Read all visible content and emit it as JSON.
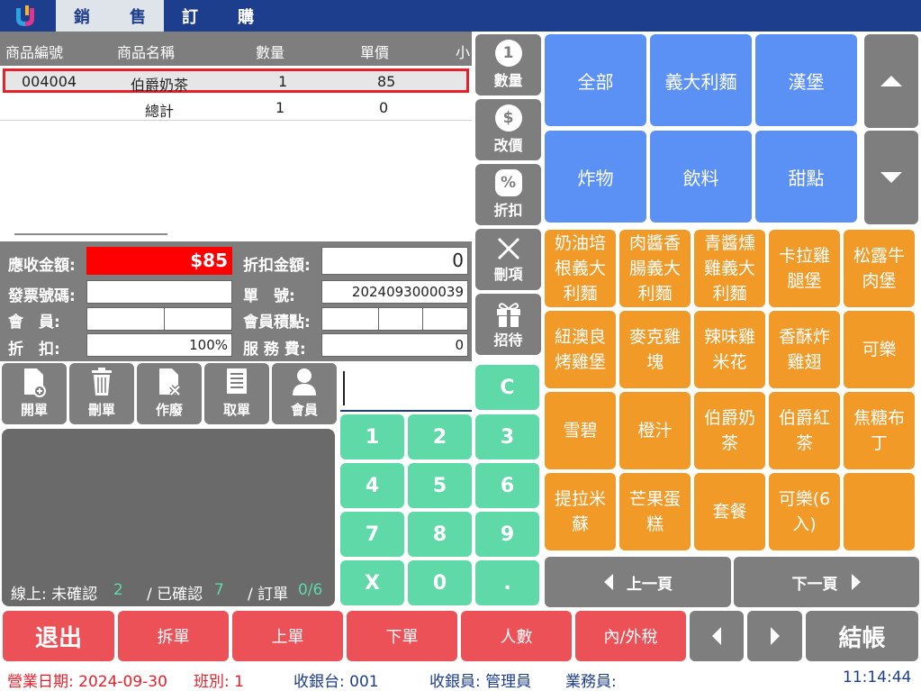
{
  "tabs": [
    {
      "label1": "銷",
      "label2": "售"
    },
    {
      "label1": "訂",
      "label2": "購"
    }
  ],
  "table": {
    "headers": [
      "商品編號",
      "商品名稱",
      "數量",
      "單價",
      "小"
    ],
    "rows": [
      {
        "code": "004004",
        "name": "伯爵奶茶",
        "qty": "1",
        "price": "85"
      }
    ],
    "total": {
      "label": "總計",
      "qty": "1",
      "price": "0"
    }
  },
  "info": {
    "receivable_label": "應收金額:",
    "receivable_value": "$85",
    "discount_amount_label": "折扣金額:",
    "discount_amount_value": "0",
    "invoice_label": "發票號碼:",
    "invoice_value": "",
    "order_no_label": "單　號:",
    "order_no_value": "2024093000039",
    "member_label": "會　員:",
    "member_points_label": "會員積點:",
    "discount_label": "折　扣:",
    "discount_value": "100%",
    "service_label": "服 務 費:",
    "service_value": "0"
  },
  "actions": [
    "開單",
    "刪單",
    "作廢",
    "取單",
    "會員"
  ],
  "status": {
    "online_label": "線上: 未確認",
    "online_value": "2",
    "confirmed_label": "/ 已確認",
    "confirmed_value": "7",
    "order_label": "/ 訂單",
    "order_value": "0/6"
  },
  "keypad": [
    "C",
    "1",
    "2",
    "3",
    "4",
    "5",
    "6",
    "7",
    "8",
    "9",
    "X",
    "0",
    "."
  ],
  "functions": [
    {
      "label": "數量",
      "icon": "1"
    },
    {
      "label": "改價",
      "icon": "$"
    },
    {
      "label": "折扣",
      "icon": "%"
    },
    {
      "label": "刪項",
      "icon": "x-icon"
    },
    {
      "label": "招待",
      "icon": "gift-icon"
    }
  ],
  "categories": [
    "全部",
    "義大利麵",
    "漢堡",
    "炸物",
    "飲料",
    "甜點"
  ],
  "products": [
    "奶油培根義大利麵",
    "肉醬香腸義大利麵",
    "青醬燻雞義大利麵",
    "卡拉雞腿堡",
    "松露牛肉堡",
    "紐澳良烤雞堡",
    "麥克雞塊",
    "辣味雞米花",
    "香酥炸雞翅",
    "可樂",
    "雪碧",
    "橙汁",
    "伯爵奶茶",
    "伯爵紅茶",
    "焦糖布丁",
    "提拉米蘇",
    "芒果蛋糕",
    "套餐",
    "可樂(6入)",
    ""
  ],
  "product_lines": [
    [
      "奶油培",
      "根義大",
      "利麵"
    ],
    [
      "肉醬香",
      "腸義大",
      "利麵"
    ],
    [
      "青醬燻",
      "雞義大",
      "利麵"
    ],
    [
      "卡拉雞",
      "腿堡"
    ],
    [
      "松露牛",
      "肉堡"
    ],
    [
      "紐澳良",
      "烤雞堡"
    ],
    [
      "麥克雞",
      "塊"
    ],
    [
      "辣味雞",
      "米花"
    ],
    [
      "香酥炸",
      "雞翅"
    ],
    [
      "可樂"
    ],
    [
      "雪碧"
    ],
    [
      "橙汁"
    ],
    [
      "伯爵奶",
      "茶"
    ],
    [
      "伯爵紅",
      "茶"
    ],
    [
      "焦糖布",
      "丁"
    ],
    [
      "提拉米",
      "蘇"
    ],
    [
      "芒果蛋",
      "糕"
    ],
    [
      "套餐"
    ],
    [
      "可樂(6",
      "入)"
    ],
    []
  ],
  "pager": {
    "prev": "上一頁",
    "next": "下一頁"
  },
  "bottom": {
    "exit": "退出",
    "split": "拆單",
    "up": "上單",
    "down": "下單",
    "people": "人數",
    "tax": "內/外稅",
    "checkout": "結帳"
  },
  "statusbar": {
    "date": "營業日期: 2024-09-30",
    "shift": "班別: 1",
    "register": "收銀台: 001",
    "cashier": "收銀員: 管理員",
    "sales": "業務員:",
    "time": "11:14:44"
  },
  "colors": {
    "topbar": "#1d3e8c",
    "category": "#5b90f5",
    "product": "#f19a28",
    "keypad": "#5fd9a8",
    "danger": "#eb5157",
    "gray": "#7e7e7e"
  }
}
